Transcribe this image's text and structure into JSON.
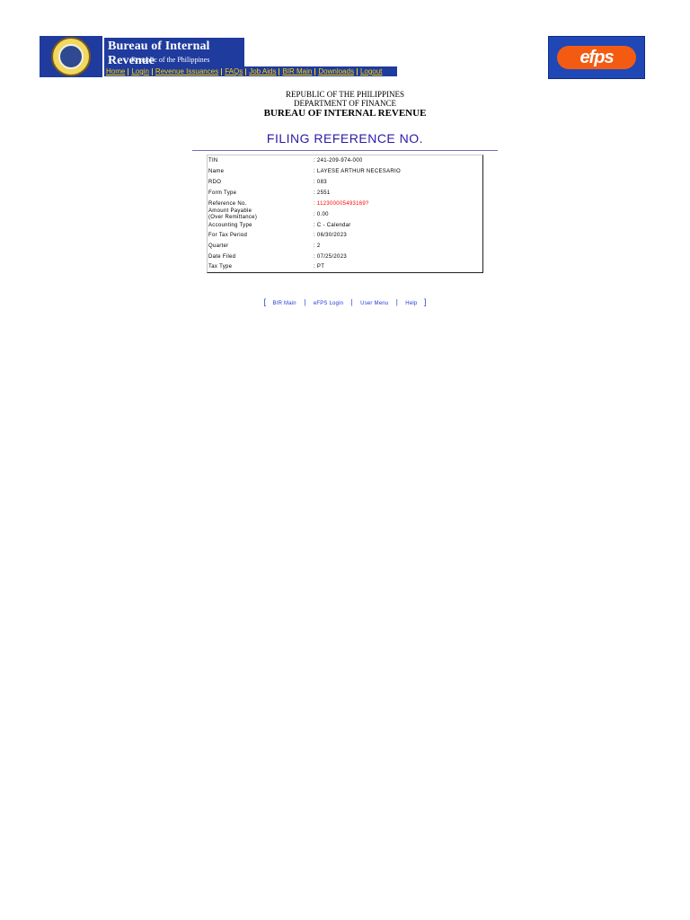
{
  "header": {
    "bureau_title": "Bureau of Internal Revenue",
    "bureau_subtitle": "Republic of the Philippines",
    "nav": [
      "Home",
      "Login",
      "Revenue Issuances",
      "FAQs",
      "Job Aids",
      "BIR Main",
      "Downloads",
      "Logout"
    ],
    "efps_logo_text": "efps",
    "colors": {
      "banner_bg": "#1f3b9d",
      "nav_text": "#ffd200",
      "efps_orange": "#f45b12"
    }
  },
  "titles": {
    "republic": "REPUBLIC OF THE PHILIPPINES",
    "department": "DEPARTMENT OF FINANCE",
    "bureau": "BUREAU OF INTERNAL REVENUE",
    "page_title": "FILING REFERENCE NO."
  },
  "details": [
    {
      "label": "TIN",
      "value": ": 241-209-974-000"
    },
    {
      "label": "Name",
      "value": ": LAYESE ARTHUR NECESARIO"
    },
    {
      "label": "RDO",
      "value": ": 083"
    },
    {
      "label": "Form Type",
      "value": ": 2551"
    },
    {
      "label": "Reference No.",
      "value": ": 112300005493169?",
      "highlight": true
    },
    {
      "label": "Amount Payable",
      "label2": "(Over Remittance)",
      "value": ": 0.00"
    },
    {
      "label": "Accounting Type",
      "value": ": C - Calendar"
    },
    {
      "label": "For Tax Period",
      "value": ": 06/30/2023"
    },
    {
      "label": "Quarter",
      "value": ": 2"
    },
    {
      "label": "Date Filed",
      "value": ": 07/25/2023"
    },
    {
      "label": "Tax Type",
      "value": ": PT"
    }
  ],
  "footer": {
    "open_bracket": "[",
    "close_bracket": "]",
    "links": [
      "BIR Main",
      "eFPS Login",
      "User Menu",
      "Help"
    ]
  }
}
